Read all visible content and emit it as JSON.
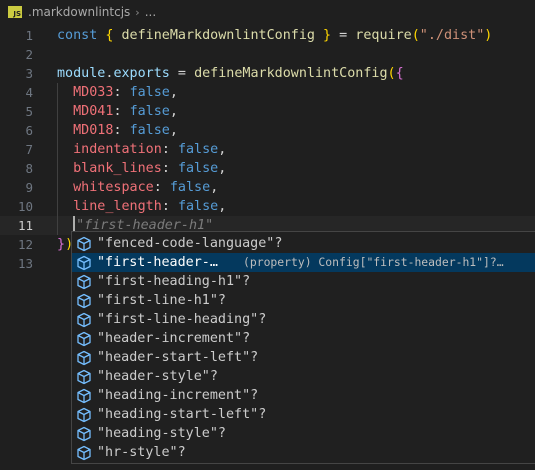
{
  "breadcrumb": {
    "file_badge": "JS",
    "file_name": ".markdownlintcjs",
    "separator": "›",
    "more": "..."
  },
  "editor": {
    "active_line": 11,
    "lines": [
      {
        "num": "1",
        "tokens": [
          [
            "kw",
            "const "
          ],
          [
            "br1",
            "{ "
          ],
          [
            "fn",
            "defineMarkdownlintConfig"
          ],
          [
            "br1",
            " }"
          ],
          [
            "plain",
            " = "
          ],
          [
            "fn",
            "require"
          ],
          [
            "br1",
            "("
          ],
          [
            "str",
            "\"./dist\""
          ],
          [
            "br1",
            ")"
          ]
        ]
      },
      {
        "num": "2",
        "tokens": []
      },
      {
        "num": "3",
        "tokens": [
          [
            "prop",
            "module"
          ],
          [
            "plain",
            "."
          ],
          [
            "prop",
            "exports"
          ],
          [
            "plain",
            " = "
          ],
          [
            "fn",
            "defineMarkdownlintConfig"
          ],
          [
            "br1",
            "("
          ],
          [
            "br2",
            "{"
          ]
        ]
      },
      {
        "num": "4",
        "tokens": [
          [
            "red",
            "  MD033"
          ],
          [
            "plain",
            ": "
          ],
          [
            "kw",
            "false"
          ],
          [
            "plain",
            ","
          ]
        ]
      },
      {
        "num": "5",
        "tokens": [
          [
            "red",
            "  MD041"
          ],
          [
            "plain",
            ": "
          ],
          [
            "kw",
            "false"
          ],
          [
            "plain",
            ","
          ]
        ]
      },
      {
        "num": "6",
        "tokens": [
          [
            "red",
            "  MD018"
          ],
          [
            "plain",
            ": "
          ],
          [
            "kw",
            "false"
          ],
          [
            "plain",
            ","
          ]
        ]
      },
      {
        "num": "7",
        "tokens": [
          [
            "red",
            "  indentation"
          ],
          [
            "plain",
            ": "
          ],
          [
            "kw",
            "false"
          ],
          [
            "plain",
            ","
          ]
        ]
      },
      {
        "num": "8",
        "tokens": [
          [
            "red",
            "  blank_lines"
          ],
          [
            "plain",
            ": "
          ],
          [
            "kw",
            "false"
          ],
          [
            "plain",
            ","
          ]
        ]
      },
      {
        "num": "9",
        "tokens": [
          [
            "red",
            "  whitespace"
          ],
          [
            "plain",
            ": "
          ],
          [
            "kw",
            "false"
          ],
          [
            "plain",
            ","
          ]
        ]
      },
      {
        "num": "10",
        "tokens": [
          [
            "red",
            "  line_length"
          ],
          [
            "plain",
            ": "
          ],
          [
            "kw",
            "false"
          ],
          [
            "plain",
            ","
          ]
        ]
      },
      {
        "num": "11",
        "tokens": [
          [
            "plain",
            "  "
          ],
          [
            "cursor",
            ""
          ],
          [
            "ghost",
            "\"first-header-h1\""
          ]
        ]
      },
      {
        "num": "12",
        "tokens": [
          [
            "br2",
            "}"
          ],
          [
            "br1",
            ")"
          ]
        ]
      },
      {
        "num": "13",
        "tokens": []
      }
    ]
  },
  "suggestions": {
    "selected_index": 1,
    "items": [
      {
        "label": "\"fenced-code-language\"?",
        "detail": ""
      },
      {
        "label": "\"first-header-…",
        "detail": "(property) Config[\"first-header-h1\"]?…"
      },
      {
        "label": "\"first-heading-h1\"?",
        "detail": ""
      },
      {
        "label": "\"first-line-h1\"?",
        "detail": ""
      },
      {
        "label": "\"first-line-heading\"?",
        "detail": ""
      },
      {
        "label": "\"header-increment\"?",
        "detail": ""
      },
      {
        "label": "\"header-start-left\"?",
        "detail": ""
      },
      {
        "label": "\"header-style\"?",
        "detail": ""
      },
      {
        "label": "\"heading-increment\"?",
        "detail": ""
      },
      {
        "label": "\"heading-start-left\"?",
        "detail": ""
      },
      {
        "label": "\"heading-style\"?",
        "detail": ""
      },
      {
        "label": "\"hr-style\"?",
        "detail": ""
      }
    ],
    "icon": "property-cube-icon"
  },
  "colors": {
    "background": "#1f1f1f",
    "keyword": "#569cd6",
    "function": "#dcdcaa",
    "string": "#ce9178",
    "property_key": "#f07178",
    "selection": "#04395e",
    "icon": "#75beff"
  }
}
